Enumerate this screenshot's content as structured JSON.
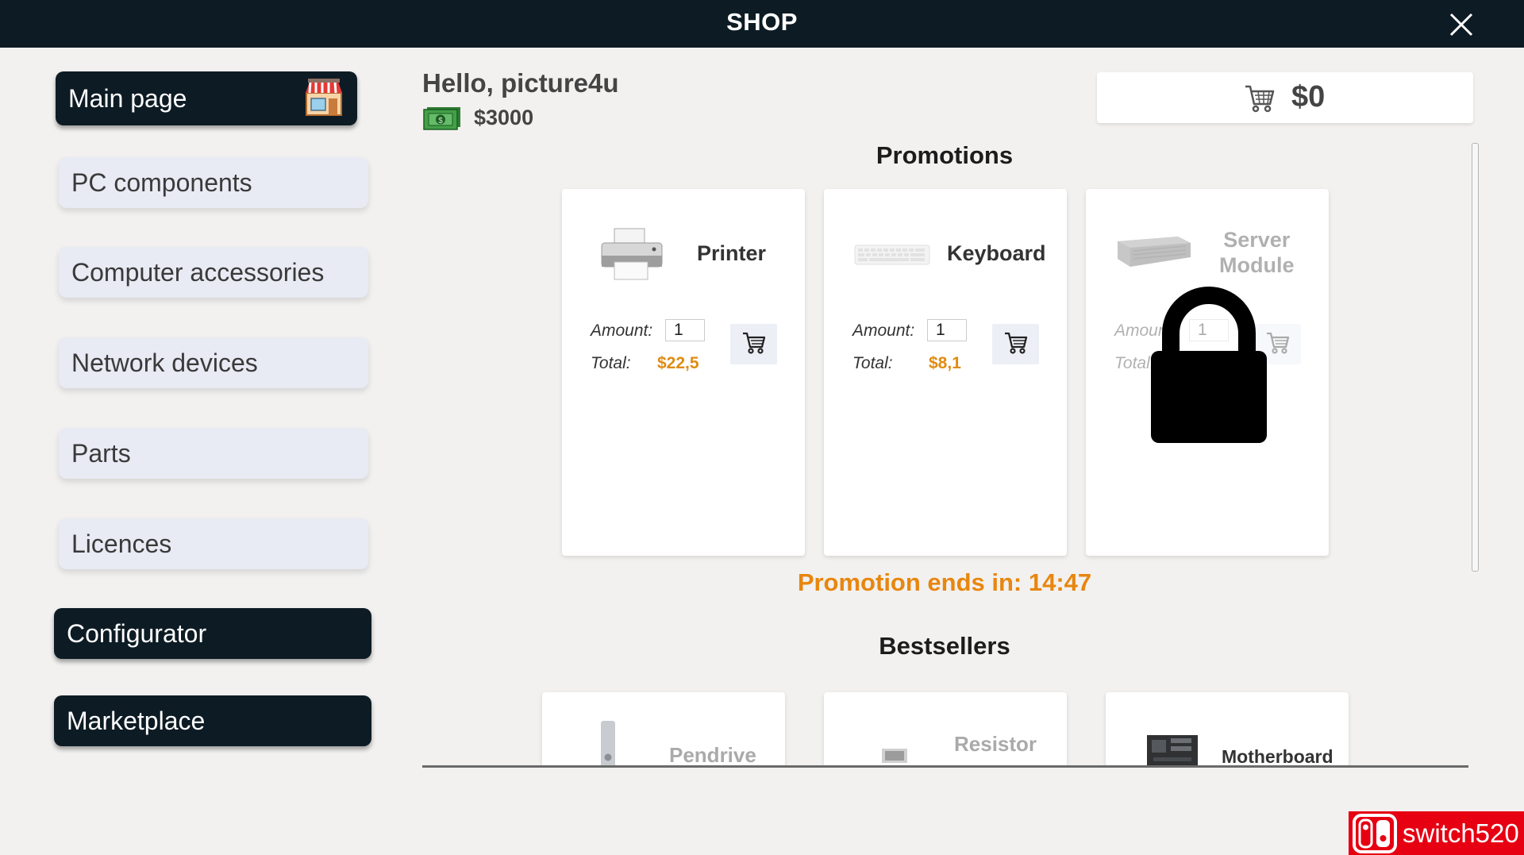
{
  "window": {
    "title": "SHOP",
    "close_icon": "close-icon"
  },
  "sidebar": {
    "main_page": {
      "label": "Main page",
      "icon": "store-icon"
    },
    "categories": [
      {
        "label": "PC components"
      },
      {
        "label": "Computer accessories"
      },
      {
        "label": "Network devices"
      },
      {
        "label": "Parts"
      },
      {
        "label": "Licences"
      }
    ],
    "configurator": {
      "label": "Configurator"
    },
    "marketplace": {
      "label": "Marketplace"
    }
  },
  "user": {
    "greeting": "Hello, picture4u",
    "balance": "$3000",
    "money_icon": "money-icon"
  },
  "cart": {
    "total": "$0",
    "icon": "shopping-cart-icon"
  },
  "promotions": {
    "title": "Promotions",
    "amount_label": "Amount:",
    "total_label": "Total:",
    "items": [
      {
        "name": "Printer",
        "amount": "1",
        "total": "$22,5",
        "icon": "printer-icon",
        "locked": false
      },
      {
        "name": "Keyboard",
        "amount": "1",
        "total": "$8,1",
        "icon": "keyboard-icon",
        "locked": false
      },
      {
        "name": "Server\nModule",
        "amount": "1",
        "total": "",
        "icon": "server-module-icon",
        "locked": true
      }
    ],
    "ends_label": "Promotion ends in:",
    "ends_time": "14:47"
  },
  "bestsellers": {
    "title": "Bestsellers",
    "items": [
      {
        "name": "Pendrive",
        "icon": "pendrive-icon"
      },
      {
        "name": "Resistor",
        "icon": "resistor-icon"
      },
      {
        "name": "Motherboard",
        "icon": "motherboard-icon"
      }
    ]
  },
  "watermark": {
    "text": "switch520"
  },
  "colors": {
    "dark": "#0d1b24",
    "accent": "#e8860f",
    "background": "#f2f1f0",
    "nav_light": "#e8eaf4"
  }
}
